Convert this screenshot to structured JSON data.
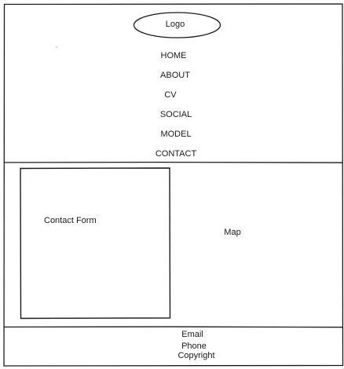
{
  "header": {
    "logo_label": "Logo"
  },
  "nav": {
    "items": [
      "HOME",
      "ABOUT",
      "CV",
      "SOCIAL",
      "MODEL",
      "CONTACT"
    ]
  },
  "main": {
    "contact_form_label": "Contact Form",
    "map_label": "Map"
  },
  "footer": {
    "email_label": "Email",
    "phone_label": "Phone",
    "copyright_label": "Copyright"
  },
  "colors": {
    "stroke": "#1a1a1a",
    "background": "#ffffff",
    "stray_mark": "#f1b8c2"
  }
}
